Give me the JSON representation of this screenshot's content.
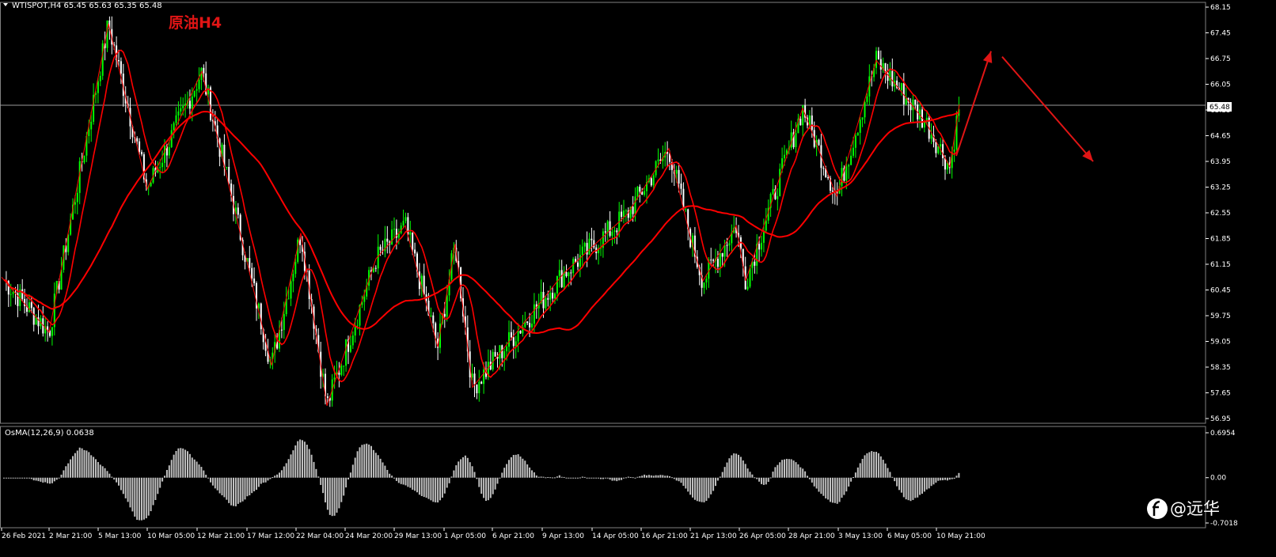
{
  "header": {
    "symbol_info": "WTISPOT,H4  65.45 65.63 65.35 65.48",
    "overlay_title": "原油H4"
  },
  "osma_label": "OsMA(12,26,9) 0.0638",
  "watermark": "@远华",
  "colors": {
    "bull": "#00ff00",
    "bear": "#ffffff",
    "ma": "#ff0000",
    "arrow": "#e01515",
    "grid": "#808080",
    "hist": "#c0c0c0"
  },
  "chart_data": [
    {
      "type": "candlestick",
      "symbol": "WTISPOT",
      "timeframe": "H4",
      "ylim": [
        56.95,
        68.15
      ],
      "y_ticks": [
        "68.15",
        "67.45",
        "66.75",
        "66.05",
        "65.35",
        "64.65",
        "63.95",
        "63.25",
        "62.55",
        "61.85",
        "61.15",
        "60.45",
        "59.75",
        "59.05",
        "58.35",
        "57.65",
        "56.95"
      ],
      "current_price": "65.48",
      "x_ticks": [
        "26 Feb 2021",
        "2 Mar 21:00",
        "5 Mar 13:00",
        "10 Mar 05:00",
        "12 Mar 21:00",
        "17 Mar 12:00",
        "22 Mar 04:00",
        "24 Mar 20:00",
        "29 Mar 13:00",
        "1 Apr 05:00",
        "6 Apr 21:00",
        "9 Apr 13:00",
        "14 Apr 05:00",
        "16 Apr 21:00",
        "21 Apr 13:00",
        "26 Apr 05:00",
        "28 Apr 21:00",
        "3 May 13:00",
        "6 May 05:00",
        "10 May 21:00"
      ],
      "swing_points": [
        {
          "x": "26 Feb 2021",
          "y": 60.8
        },
        {
          "x": "2 Mar 21:00",
          "y": 59.3
        },
        {
          "x": "5 Mar 13:00",
          "y": 67.7
        },
        {
          "x": "10 Mar 05:00",
          "y": 63.2
        },
        {
          "x": "12 Mar 21:00",
          "y": 66.4
        },
        {
          "x": "17 Mar 12:00",
          "y": 58.4
        },
        {
          "x": "22 Mar 04:00",
          "y": 62.0
        },
        {
          "x": "22 Mar 04:00",
          "y": 57.3
        },
        {
          "x": "24 Mar 20:00",
          "y": 61.3
        },
        {
          "x": "29 Mar 13:00",
          "y": 62.2
        },
        {
          "x": "1 Apr 05:00",
          "y": 58.9
        },
        {
          "x": "1 Apr 05:00",
          "y": 61.7
        },
        {
          "x": "6 Apr 21:00",
          "y": 57.8
        },
        {
          "x": "9 Apr 13:00",
          "y": 60.9
        },
        {
          "x": "14 Apr 05:00",
          "y": 62.5
        },
        {
          "x": "16 Apr 21:00",
          "y": 64.3
        },
        {
          "x": "21 Apr 13:00",
          "y": 61.9
        },
        {
          "x": "21 Apr 13:00",
          "y": 60.7
        },
        {
          "x": "26 Apr 05:00",
          "y": 62.2
        },
        {
          "x": "26 Apr 05:00",
          "y": 60.7
        },
        {
          "x": "28 Apr 21:00",
          "y": 65.4
        },
        {
          "x": "28 Apr 21:00",
          "y": 63.0
        },
        {
          "x": "3 May 13:00",
          "y": 66.7
        },
        {
          "x": "6 May 05:00",
          "y": 65.0
        },
        {
          "x": "10 May 21:00",
          "y": 63.8
        },
        {
          "x": "10 May 21:00",
          "y": 65.5
        }
      ]
    },
    {
      "type": "bar",
      "indicator": "OsMA",
      "params": "12,26,9",
      "ylim": [
        -0.7018,
        0.6954
      ],
      "y_ticks": [
        "0.6954",
        "0.00",
        "-0.7018"
      ]
    }
  ]
}
